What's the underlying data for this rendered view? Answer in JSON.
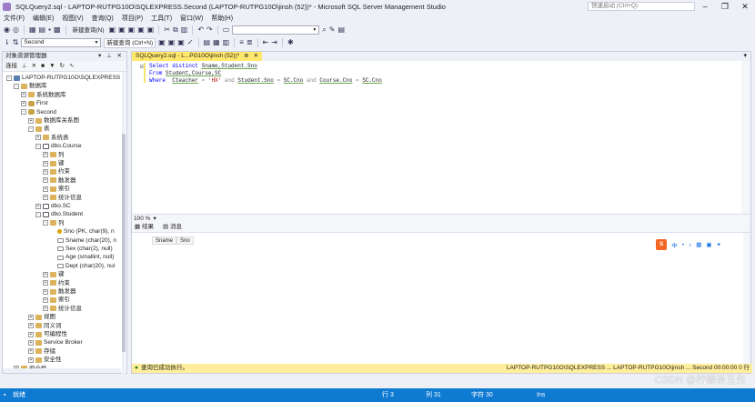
{
  "window": {
    "title": "SQLQuery2.sql - LAPTOP-RUTPG10O\\SQLEXPRESS.Second (LAPTOP-RUTPG10O\\jinsh (52))* - Microsoft SQL Server Management Studio",
    "quick_launch_placeholder": "快速启动 (Ctrl+Q)",
    "min": "–",
    "max": "❐",
    "close": "✕"
  },
  "menu": [
    "文件(F)",
    "编辑(E)",
    "视图(V)",
    "查询(Q)",
    "项目(P)",
    "工具(T)",
    "窗口(W)",
    "帮助(H)"
  ],
  "toolbar": {
    "new_query": "新建查询(N)",
    "database": "Second",
    "new_query_tooltip": "新建查询 (Ctrl+N)"
  },
  "object_explorer": {
    "title": "对象资源管理器",
    "connect": "连接",
    "nodes": [
      {
        "label": "LAPTOP-RUTPG10O\\SQLEXPRESS",
        "icon": "srv",
        "level": 0,
        "exp": "-"
      },
      {
        "label": "数据库",
        "icon": "folder",
        "level": 1,
        "exp": "-"
      },
      {
        "label": "系统数据库",
        "icon": "folder",
        "level": 2,
        "exp": "+"
      },
      {
        "label": "First",
        "icon": "db",
        "level": 2,
        "exp": "+"
      },
      {
        "label": "Second",
        "icon": "db",
        "level": 2,
        "exp": "-"
      },
      {
        "label": "数据库关系图",
        "icon": "folder",
        "level": 3,
        "exp": "+"
      },
      {
        "label": "表",
        "icon": "folder",
        "level": 3,
        "exp": "-"
      },
      {
        "label": "系统表",
        "icon": "folder",
        "level": 4,
        "exp": "+"
      },
      {
        "label": "dbo.Course",
        "icon": "tbl",
        "level": 4,
        "exp": "-"
      },
      {
        "label": "列",
        "icon": "folder",
        "level": 5,
        "exp": "+"
      },
      {
        "label": "键",
        "icon": "folder",
        "level": 5,
        "exp": "+"
      },
      {
        "label": "约束",
        "icon": "folder",
        "level": 5,
        "exp": "+"
      },
      {
        "label": "触发器",
        "icon": "folder",
        "level": 5,
        "exp": "+"
      },
      {
        "label": "索引",
        "icon": "folder",
        "level": 5,
        "exp": "+"
      },
      {
        "label": "统计信息",
        "icon": "folder",
        "level": 5,
        "exp": "+"
      },
      {
        "label": "dbo.SC",
        "icon": "tbl",
        "level": 4,
        "exp": "+"
      },
      {
        "label": "dbo.Student",
        "icon": "tbl",
        "level": 4,
        "exp": "-"
      },
      {
        "label": "列",
        "icon": "folder",
        "level": 5,
        "exp": "-"
      },
      {
        "label": "Sno (PK, char(9), n",
        "icon": "key",
        "level": 6,
        "exp": ""
      },
      {
        "label": "Sname (char(20), n",
        "icon": "col",
        "level": 6,
        "exp": ""
      },
      {
        "label": "Sex (char(2), null)",
        "icon": "col",
        "level": 6,
        "exp": ""
      },
      {
        "label": "Age (smallint, null)",
        "icon": "col",
        "level": 6,
        "exp": ""
      },
      {
        "label": "Dept (char(20), nul",
        "icon": "col",
        "level": 6,
        "exp": ""
      },
      {
        "label": "键",
        "icon": "folder",
        "level": 5,
        "exp": "+"
      },
      {
        "label": "约束",
        "icon": "folder",
        "level": 5,
        "exp": "+"
      },
      {
        "label": "触发器",
        "icon": "folder",
        "level": 5,
        "exp": "+"
      },
      {
        "label": "索引",
        "icon": "folder",
        "level": 5,
        "exp": "+"
      },
      {
        "label": "统计信息",
        "icon": "folder",
        "level": 5,
        "exp": "+"
      },
      {
        "label": "视图",
        "icon": "folder",
        "level": 3,
        "exp": "+"
      },
      {
        "label": "同义词",
        "icon": "folder",
        "level": 3,
        "exp": "+"
      },
      {
        "label": "可编程性",
        "icon": "folder",
        "level": 3,
        "exp": "+"
      },
      {
        "label": "Service Broker",
        "icon": "folder",
        "level": 3,
        "exp": "+"
      },
      {
        "label": "存储",
        "icon": "folder",
        "level": 3,
        "exp": "+"
      },
      {
        "label": "安全性",
        "icon": "folder",
        "level": 3,
        "exp": "+"
      },
      {
        "label": "安全性",
        "icon": "folder",
        "level": 1,
        "exp": "+"
      }
    ]
  },
  "editor": {
    "tab_label": "SQLQuery2.sql - L...PG10O\\jinsh (52))*",
    "tab_pin": "⊕",
    "tab_close": "✕",
    "line1": {
      "kw1": "Select",
      "kw2": "distinct",
      "cols": "Sname,Student.Sno"
    },
    "line2": {
      "kw": "From",
      "tables": "Student,Course,SC"
    },
    "line3": {
      "kw": "Where",
      "col": "Cteacher",
      "op": "=",
      "str": "'HX'",
      "and1": "and",
      "cond1": "Student.Sno",
      "eq1": "=",
      "cond1b": "SC.Cno",
      "and2": "and",
      "cond2": "Course.Cno",
      "eq2": "=",
      "cond2b": "SC.Cno"
    },
    "zoom": "100 %"
  },
  "results": {
    "tab_results": "结果",
    "tab_messages": "消息",
    "columns": [
      "Sname",
      "Sno"
    ],
    "status": "查询已成功执行。",
    "server_info": "LAPTOP-RUTPG10O\\SQLEXPRESS ...  LAPTOP-RUTPG10O\\jinsh ...  Second  00:00:00  0 行",
    "ime": [
      "中",
      "•",
      "♪",
      "▦",
      "▣",
      "✦"
    ]
  },
  "statusbar": {
    "ready": "就绪",
    "row": "行 3",
    "col": "列 31",
    "char": "字符 30",
    "ins": "Ins"
  },
  "watermark": "CSDN @柠檬茶丑先"
}
